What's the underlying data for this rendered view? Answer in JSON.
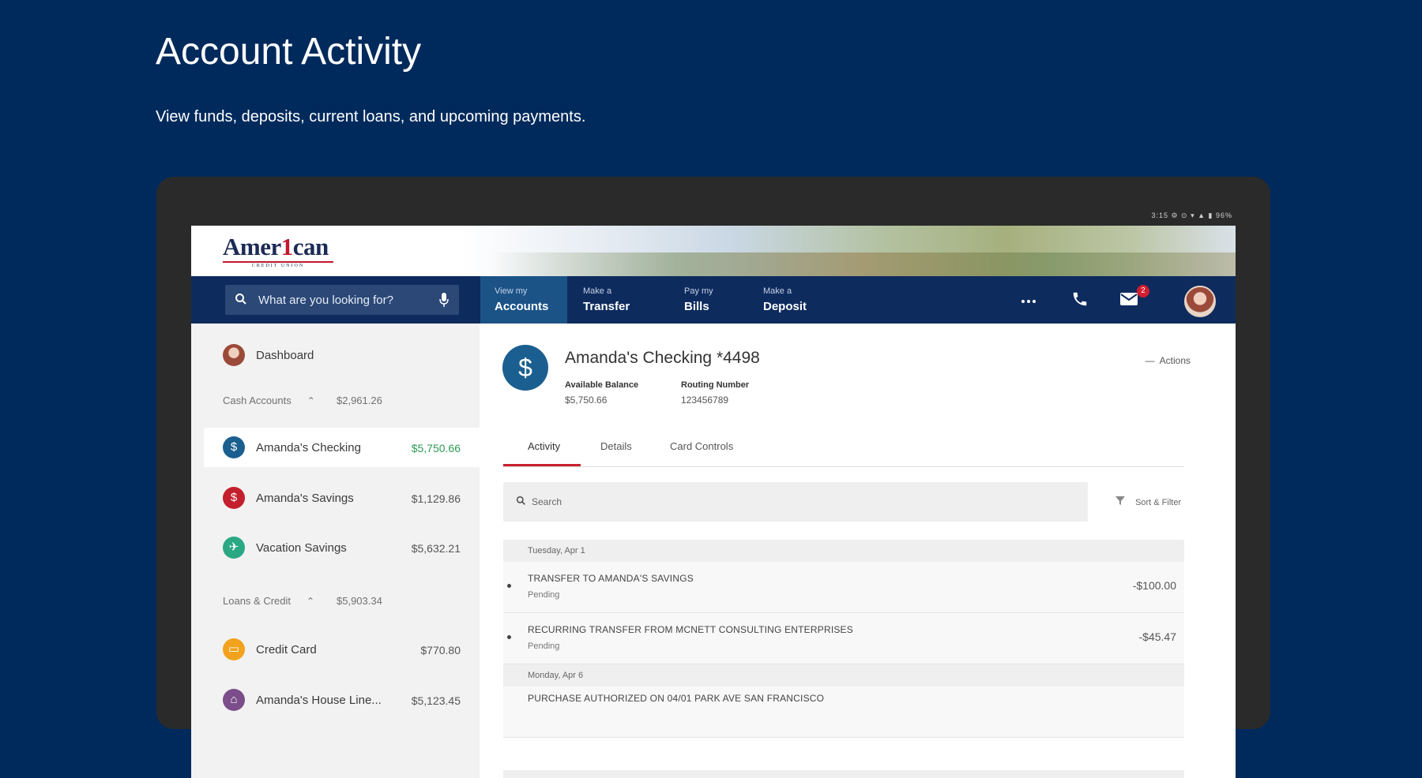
{
  "promo": {
    "title": "Account Activity",
    "subtitle": "View funds, deposits, current loans, and upcoming payments."
  },
  "device": {
    "status_bar": "3:15 ⚙ ⊙ ▾ ▲ ▮ 96%"
  },
  "brand": {
    "logo_text_a": "Amer",
    "logo_text_one": "1",
    "logo_text_b": "can",
    "logo_sub": "CREDIT UNION"
  },
  "nav": {
    "search_placeholder": "What are you looking for?",
    "items": [
      {
        "small": "View my",
        "big": "Accounts"
      },
      {
        "small": "Make a",
        "big": "Transfer"
      },
      {
        "small": "Pay my",
        "big": "Bills"
      },
      {
        "small": "Make a",
        "big": "Deposit"
      }
    ],
    "more_icon": "more-icon",
    "phone_icon": "phone-icon",
    "mail_icon": "mail-icon",
    "mail_badge": "2"
  },
  "sidebar": {
    "dashboard": "Dashboard",
    "cash_group": {
      "label": "Cash Accounts",
      "amount": "$2,961.26"
    },
    "accounts": [
      {
        "label": "Amanda's Checking",
        "amount": "$5,750.66",
        "icon": "$",
        "color": "#1a5f8f"
      },
      {
        "label": "Amanda's Savings",
        "amount": "$1,129.86",
        "icon": "$",
        "color": "#c41f2d"
      },
      {
        "label": "Vacation Savings",
        "amount": "$5,632.21",
        "icon": "✈",
        "color": "#2aa884"
      }
    ],
    "loans_group": {
      "label": "Loans & Credit",
      "amount": "$5,903.34"
    },
    "loans": [
      {
        "label": "Credit Card",
        "amount": "$770.80",
        "icon": "▭",
        "color": "#f2a21c"
      },
      {
        "label": "Amanda's House Line...",
        "amount": "$5,123.45",
        "icon": "⌂",
        "color": "#7b4d8a"
      }
    ]
  },
  "account": {
    "title": "Amanda's Checking",
    "suffix": "*4498",
    "actions": "Actions",
    "available_label": "Available Balance",
    "available_value": "$5,750.66",
    "routing_label": "Routing Number",
    "routing_value": "123456789"
  },
  "tabs": [
    "Activity",
    "Details",
    "Card Controls"
  ],
  "transactions": {
    "search_placeholder": "Search",
    "sort_label": "Sort & Filter",
    "groups": [
      {
        "date": "Tuesday, Apr 1",
        "items": [
          {
            "desc": "TRANSFER TO AMANDA'S SAVINGS",
            "status": "Pending",
            "amount": "-$100.00"
          },
          {
            "desc": "RECURRING TRANSFER FROM MCNETT CONSULTING ENTERPRISES",
            "status": "Pending",
            "amount": "-$45.47"
          }
        ]
      },
      {
        "date": "Monday, Apr 6",
        "items": [
          {
            "desc": "PURCHASE AUTHORIZED ON 04/01 PARK AVE SAN FRANCISCO",
            "status": "",
            "amount": ""
          }
        ]
      }
    ]
  }
}
